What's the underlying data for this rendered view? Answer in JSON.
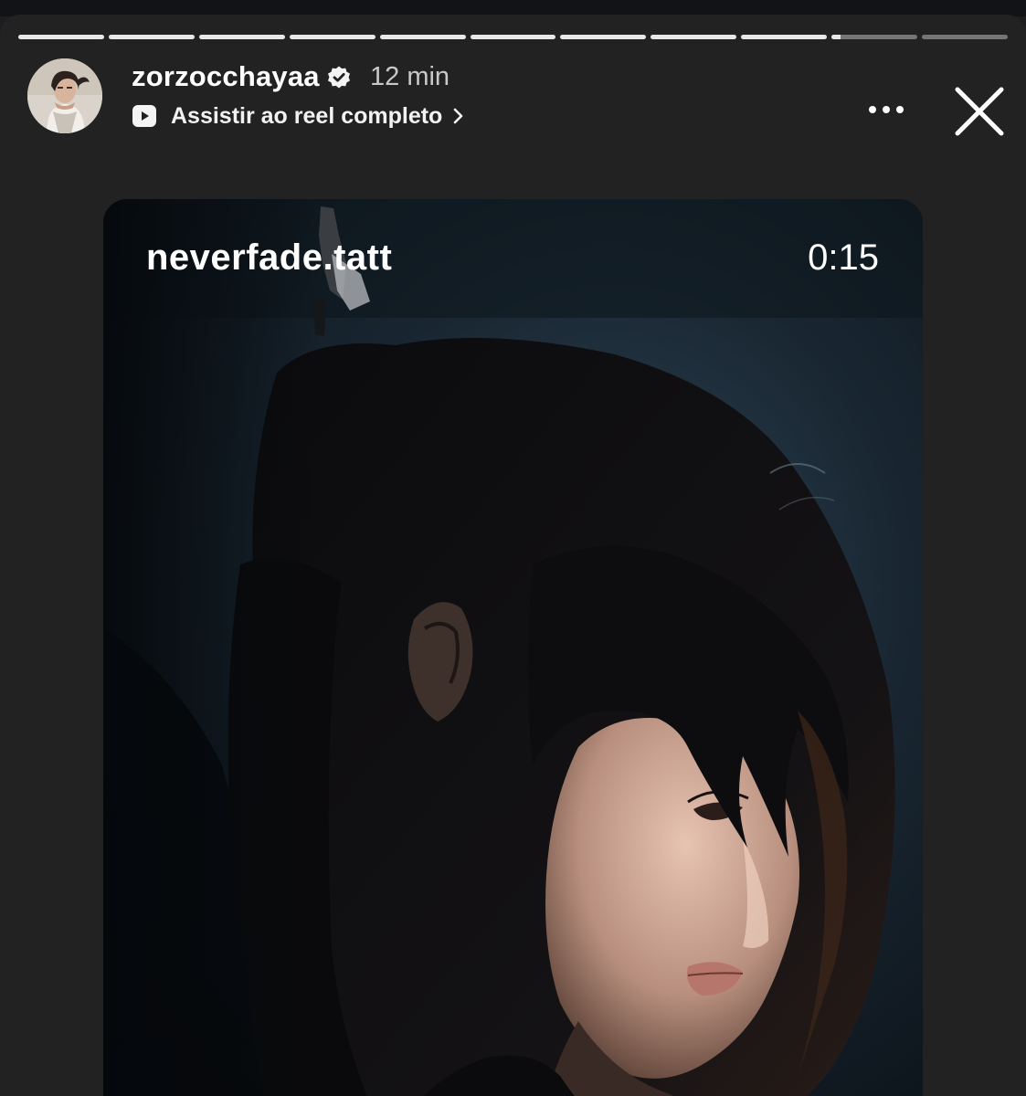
{
  "story": {
    "segment_count": 11,
    "segment_progress": [
      1,
      1,
      1,
      1,
      1,
      1,
      1,
      1,
      1,
      0.1,
      0
    ],
    "username": "zorzocchayaa",
    "verified": true,
    "time_ago": "12 min",
    "reel_link_label": "Assistir ao reel completo"
  },
  "reel": {
    "author": "neverfade.tatt",
    "duration": "0:15"
  },
  "icons": {
    "verified": "verified-badge-icon",
    "reel": "reel-play-icon",
    "chevron": "chevron-right-icon",
    "more": "more-horizontal-icon",
    "close": "close-icon"
  },
  "colors": {
    "background": "#222222",
    "top_strip": "#121316",
    "progress_filled": "#e8e8e8",
    "progress_empty": "#5c5c5c",
    "secondary_text": "#c9c9c9",
    "reel_background": "#111a21"
  }
}
